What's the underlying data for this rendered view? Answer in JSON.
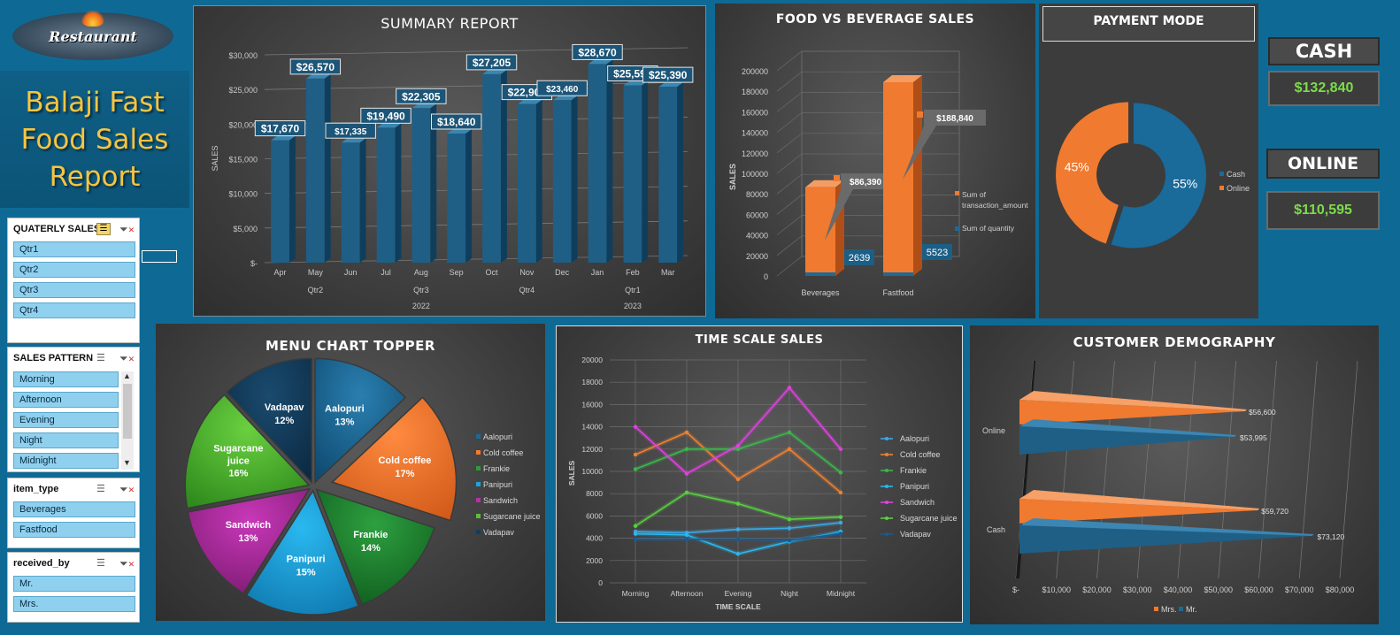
{
  "logo": {
    "text": "Restaurant"
  },
  "report_title": [
    "Balaji Fast",
    "Food Sales",
    "Report"
  ],
  "slicers": {
    "quarterly": {
      "title": "QUATERLY SALES",
      "items": [
        "Qtr1",
        "Qtr2",
        "Qtr3",
        "Qtr4"
      ]
    },
    "pattern": {
      "title": "SALES PATTERN",
      "items": [
        "Morning",
        "Afternoon",
        "Evening",
        "Night",
        "Midnight"
      ]
    },
    "item_type": {
      "title": "item_type",
      "items": [
        "Beverages",
        "Fastfood"
      ]
    },
    "received_by": {
      "title": "received_by",
      "items": [
        "Mr.",
        "Mrs."
      ]
    }
  },
  "kpi": {
    "cash_label": "CASH",
    "cash_value": "$132,840",
    "online_label": "ONLINE",
    "online_value": "$110,595"
  },
  "chart_data": [
    {
      "type": "bar",
      "title": "SUMMARY REPORT",
      "ylabel": "SALES",
      "categories": [
        "Apr",
        "May",
        "Jun",
        "Jul",
        "Aug",
        "Sep",
        "Oct",
        "Nov",
        "Dec",
        "Jan",
        "Feb",
        "Mar"
      ],
      "values": [
        17670,
        26570,
        17335,
        19490,
        22305,
        18640,
        27205,
        22900,
        23460,
        28670,
        25595,
        25390
      ],
      "data_labels": [
        "$17,670",
        "$26,570",
        "$17,335",
        "$19,490",
        "$22,305",
        "$18,640",
        "$27,205",
        "$22,900",
        "$23,460",
        "$28,670",
        "$25,595",
        "$25,390"
      ],
      "yticks": [
        "$-",
        "$5,000",
        "$10,000",
        "$15,000",
        "$20,000",
        "$25,000",
        "$30,000"
      ],
      "ylim": [
        0,
        30000
      ],
      "quarter_labels": [
        "Qtr2",
        "Qtr3",
        "Qtr4",
        "Qtr1"
      ],
      "year_labels": [
        "2022",
        "2023"
      ]
    },
    {
      "type": "bar",
      "title": "FOOD VS BEVERAGE SALES",
      "ylabel": "SALES",
      "categories": [
        "Beverages",
        "Fastfood"
      ],
      "series": [
        {
          "name": "Sum of transaction_amount",
          "values": [
            86390,
            188840
          ],
          "labels": [
            "$86,390",
            "$188,840"
          ]
        },
        {
          "name": "Sum of quantity",
          "values": [
            2639,
            5523
          ],
          "labels": [
            "2639",
            "5523"
          ]
        }
      ],
      "yticks": [
        "0",
        "20000",
        "40000",
        "60000",
        "80000",
        "100000",
        "120000",
        "140000",
        "160000",
        "180000",
        "200000"
      ],
      "ylim": [
        0,
        200000
      ]
    },
    {
      "type": "pie",
      "title": "PAYMENT MODE",
      "categories": [
        "Cash",
        "Online"
      ],
      "values": [
        55,
        45
      ],
      "labels": [
        "55%",
        "45%"
      ]
    },
    {
      "type": "pie",
      "title": "MENU CHART TOPPER",
      "categories": [
        "Aalopuri",
        "Cold coffee",
        "Frankie",
        "Panipuri",
        "Sandwich",
        "Sugarcane juice",
        "Vadapav"
      ],
      "values": [
        13,
        17,
        14,
        15,
        13,
        16,
        12
      ],
      "slice_names": [
        "Aalopuri",
        "Cold coffee",
        "Frankie",
        "Panipuri",
        "Sandwich",
        "Sugarcane juice",
        "Vadapav"
      ],
      "labels": [
        "13%",
        "17%",
        "14%",
        "15%",
        "13%",
        "16%",
        "12%"
      ]
    },
    {
      "type": "line",
      "title": "TIME SCALE SALES",
      "xlabel": "TIME SCALE",
      "ylabel": "SALES",
      "x": [
        "Morning",
        "Afternoon",
        "Evening",
        "Night",
        "Midnight"
      ],
      "yticks": [
        "0",
        "2000",
        "4000",
        "6000",
        "8000",
        "10000",
        "12000",
        "14000",
        "16000",
        "18000",
        "20000"
      ],
      "ylim": [
        0,
        20000
      ],
      "series": [
        {
          "name": "Aalopuri",
          "values": [
            4600,
            4500,
            4800,
            4900,
            5400
          ]
        },
        {
          "name": "Cold coffee",
          "values": [
            11500,
            13500,
            9300,
            12000,
            8100
          ]
        },
        {
          "name": "Frankie",
          "values": [
            10200,
            12000,
            12000,
            13500,
            9900
          ]
        },
        {
          "name": "Panipuri",
          "values": [
            4400,
            4300,
            2600,
            3700,
            4600
          ]
        },
        {
          "name": "Sandwich",
          "values": [
            14000,
            9800,
            12300,
            17500,
            12000
          ]
        },
        {
          "name": "Sugarcane juice",
          "values": [
            5100,
            8100,
            7100,
            5700,
            5900
          ]
        },
        {
          "name": "Vadapav",
          "values": [
            3900,
            3900,
            3900,
            3800,
            4400
          ]
        }
      ]
    },
    {
      "type": "bar",
      "title": "CUSTOMER DEMOGRAPHY",
      "categories": [
        "Online",
        "Cash"
      ],
      "series": [
        {
          "name": "Mrs.",
          "values": [
            56600,
            59720
          ],
          "labels": [
            "$56,600",
            "$59,720"
          ]
        },
        {
          "name": "Mr.",
          "values": [
            53995,
            73120
          ],
          "labels": [
            "$53,995",
            "$73,120"
          ]
        }
      ],
      "xticks": [
        "$-",
        "$10,000",
        "$20,000",
        "$30,000",
        "$40,000",
        "$50,000",
        "$60,000",
        "$70,000",
        "$80,000"
      ],
      "xlim": [
        0,
        80000
      ]
    }
  ],
  "colors": {
    "page_bg": "#0e6a95",
    "bar_blue": "#1f5f86",
    "orange": "#f07a30",
    "kpi_green": "#7ddc4a",
    "pie": [
      "#1a6a9a",
      "#f37a2e",
      "#2e9a3a",
      "#1ea3e0",
      "#b830a8",
      "#5bbf3a",
      "#123f5e"
    ],
    "lines": [
      "#3aa8e8",
      "#f08030",
      "#3ab84a",
      "#28b8f0",
      "#e040e0",
      "#58d040",
      "#1a5a90"
    ]
  }
}
